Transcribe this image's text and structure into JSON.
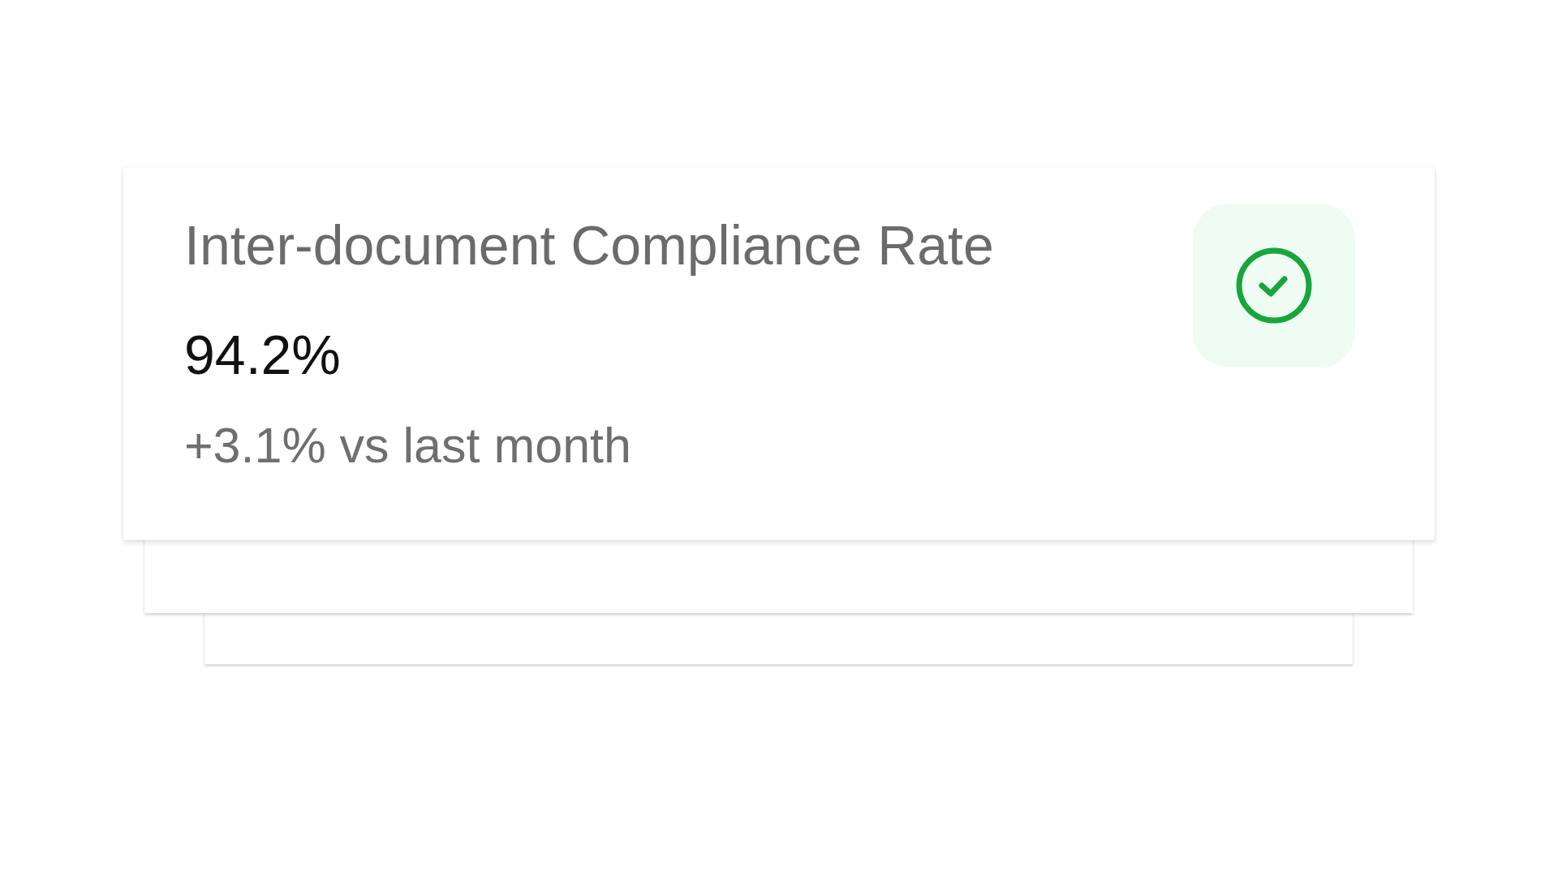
{
  "card": {
    "title": "Inter-document Compliance Rate",
    "value": "94.2%",
    "change": "+3.1% vs last month",
    "positive": true
  }
}
